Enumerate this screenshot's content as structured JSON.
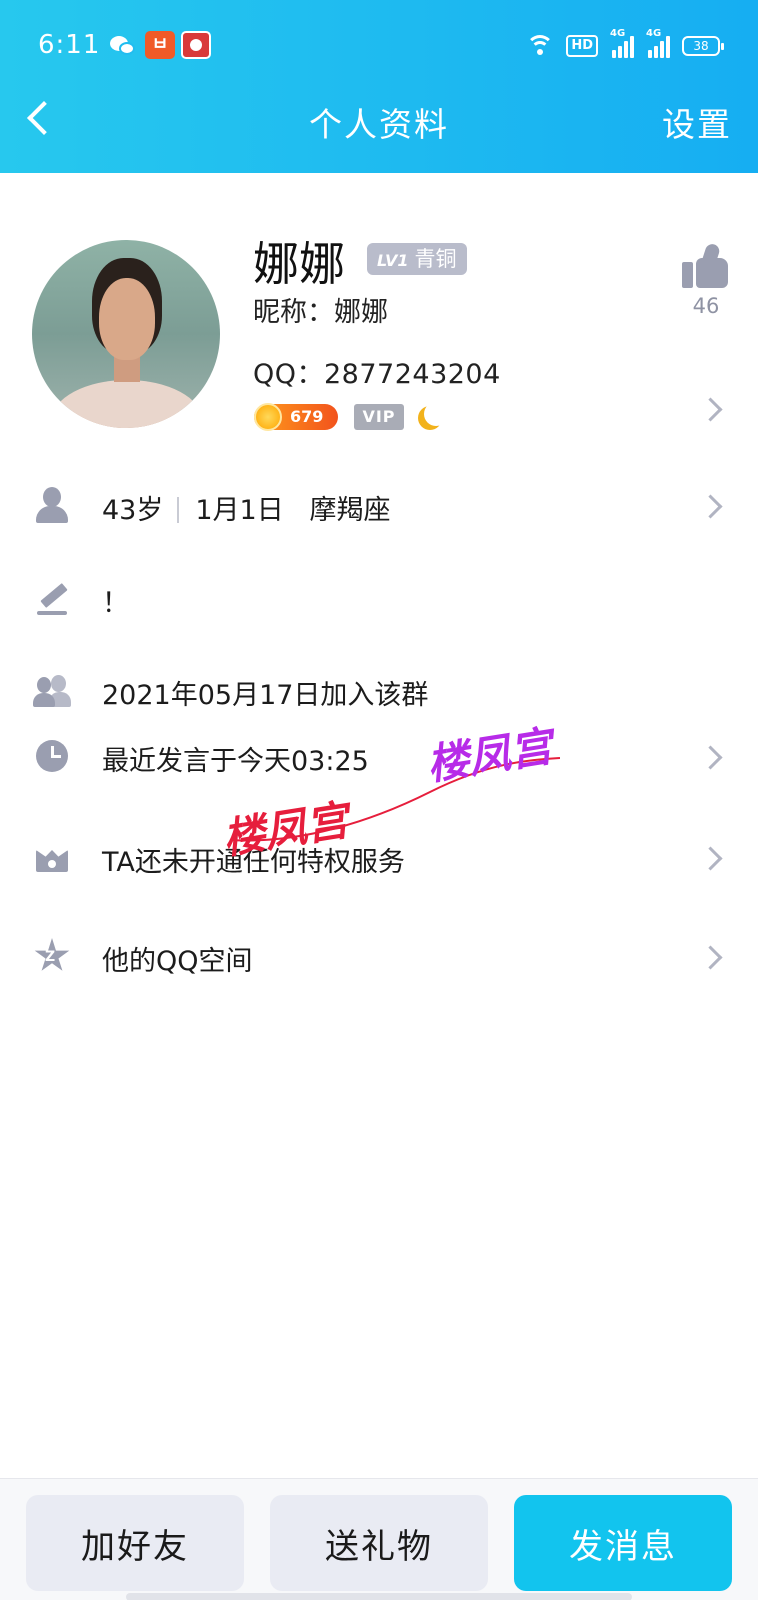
{
  "status_bar": {
    "time": "6:11",
    "app2_glyph": "ㅂ",
    "hd_label": "HD",
    "signal_1": "4G",
    "signal_2": "4G",
    "battery": "38",
    "icons": [
      "wechat-icon",
      "app-icon",
      "app-icon",
      "wifi-icon",
      "hd-icon",
      "signal-4g-icon",
      "signal-4g-icon",
      "battery-icon"
    ]
  },
  "header": {
    "title": "个人资料",
    "settings_label": "设置",
    "back_icon": "chevron-left-icon",
    "colors": {
      "start": "#27c8ee",
      "end": "#16aef2"
    }
  },
  "profile": {
    "display_name": "娜娜",
    "level_prefix": "LV1",
    "level_label": "青铜",
    "nickname": "昵称：娜娜",
    "qq": "QQ：2877243204",
    "coins": "679",
    "vip_label": "VIP",
    "likes": "46"
  },
  "rows": {
    "age": "43岁",
    "birthday": "1月1日",
    "zodiac": "摩羯座",
    "signature": "！",
    "joined": "2021年05月17日加入该群",
    "last_spoke": "最近发言于今天03:25",
    "privilege": "TA还未开通任何特权服务",
    "qzone": "他的QQ空间"
  },
  "watermark": {
    "text_1": "楼凤宫",
    "text_2": "楼凤宫"
  },
  "footer": {
    "add_friend": "加好友",
    "send_gift": "送礼物",
    "send_message": "发消息",
    "accent": "#12c4ee"
  }
}
